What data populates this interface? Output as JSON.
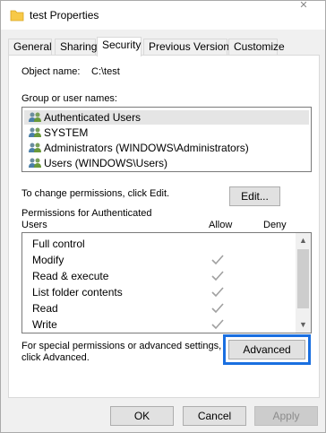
{
  "window": {
    "title": "test Properties",
    "close_symbol": "✕"
  },
  "tabs": [
    {
      "label": "General"
    },
    {
      "label": "Sharing"
    },
    {
      "label": "Security"
    },
    {
      "label": "Previous Versions"
    },
    {
      "label": "Customize"
    }
  ],
  "active_tab": "Security",
  "security": {
    "object_name_label": "Object name:",
    "object_name_value": "C:\\test",
    "group_label": "Group or user names:",
    "groups": [
      {
        "name": "Authenticated Users",
        "icon": "users-icon",
        "selected": true
      },
      {
        "name": "SYSTEM",
        "icon": "users-icon",
        "selected": false
      },
      {
        "name": "Administrators (WINDOWS\\Administrators)",
        "icon": "users-icon",
        "selected": false
      },
      {
        "name": "Users (WINDOWS\\Users)",
        "icon": "users-icon",
        "selected": false
      }
    ],
    "change_text": "To change permissions, click Edit.",
    "edit_label": "Edit...",
    "permissions_for_line1": "Permissions for Authenticated",
    "permissions_for_line2": "Users",
    "allow_header": "Allow",
    "deny_header": "Deny",
    "permissions": [
      {
        "name": "Full control",
        "allow": false,
        "deny": false
      },
      {
        "name": "Modify",
        "allow": true,
        "deny": false
      },
      {
        "name": "Read & execute",
        "allow": true,
        "deny": false
      },
      {
        "name": "List folder contents",
        "allow": true,
        "deny": false
      },
      {
        "name": "Read",
        "allow": true,
        "deny": false
      },
      {
        "name": "Write",
        "allow": true,
        "deny": false
      }
    ],
    "special_line1": "For special permissions or advanced settings,",
    "special_line2": "click Advanced.",
    "advanced_label": "Advanced"
  },
  "footer": {
    "ok_label": "OK",
    "cancel_label": "Cancel",
    "apply_label": "Apply"
  },
  "colors": {
    "focus_ring": "#1a6fe0",
    "check_gray": "#a0a0a0",
    "folder_yellow": "#f7c948"
  }
}
